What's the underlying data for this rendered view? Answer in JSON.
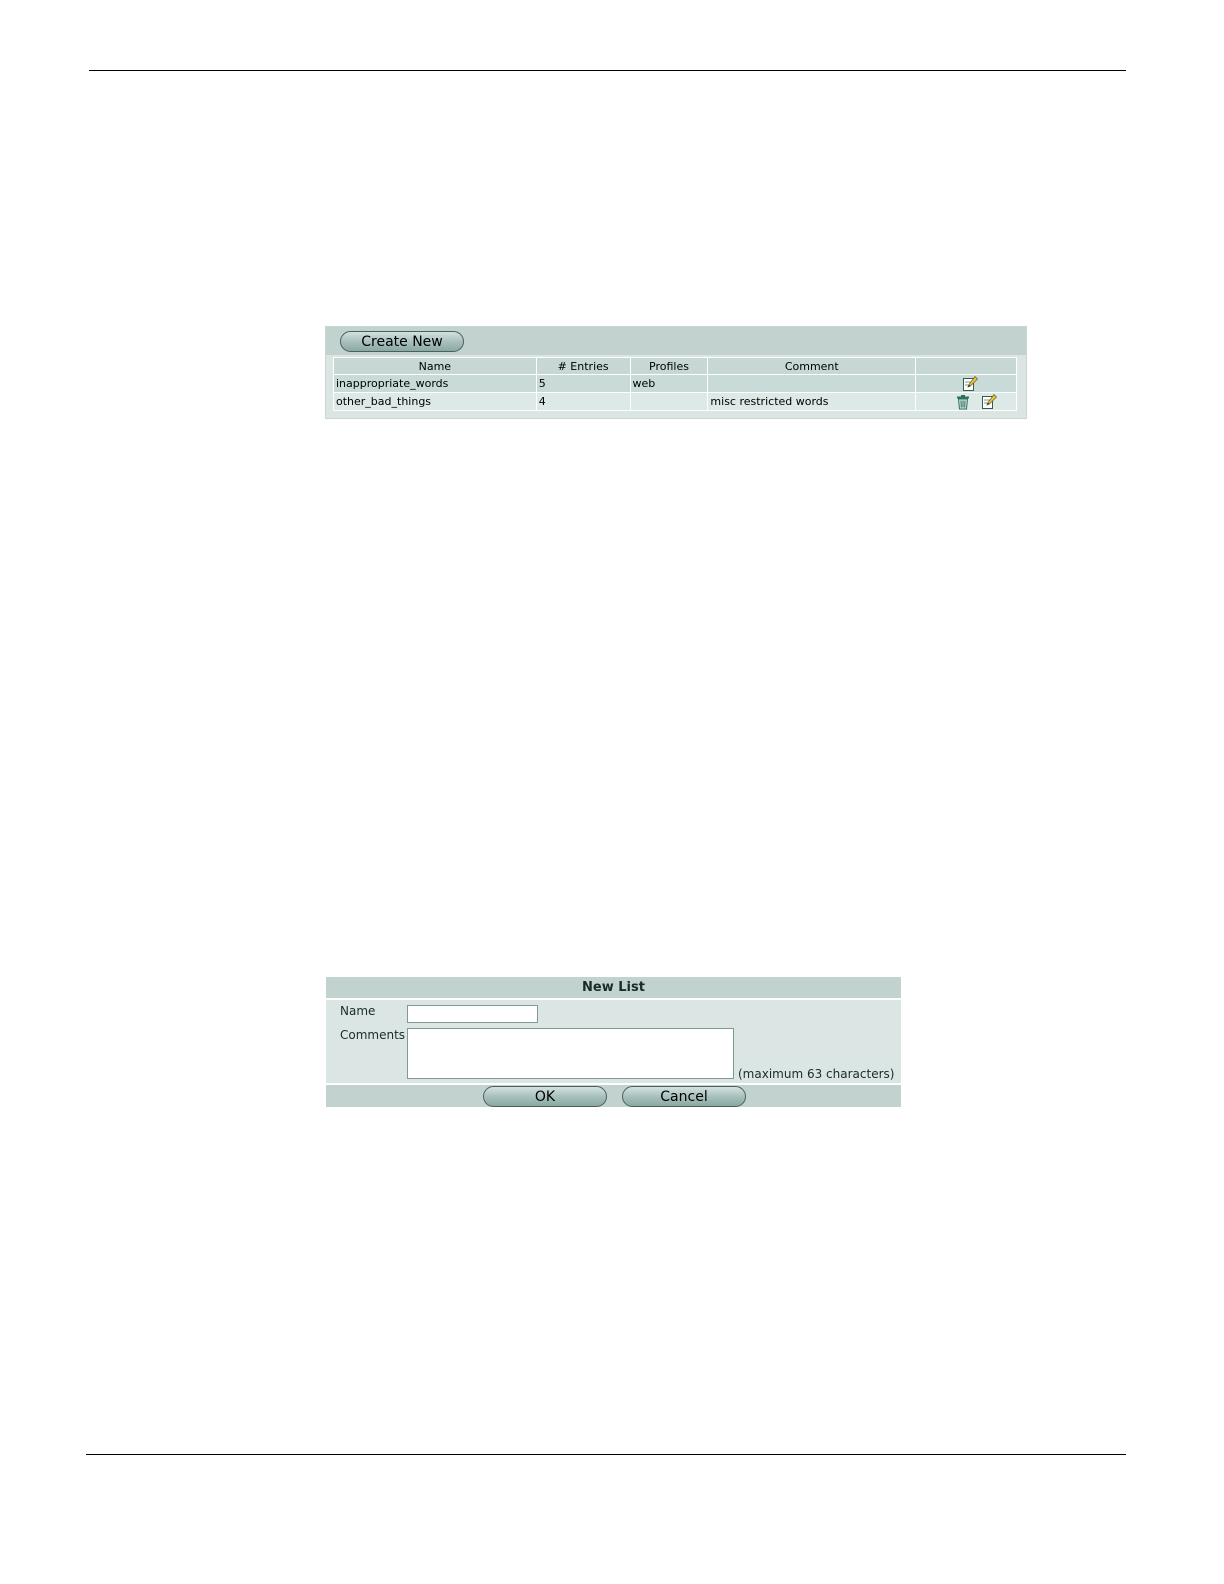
{
  "list_panel": {
    "create_new_label": "Create New",
    "columns": [
      "Name",
      "# Entries",
      "Profiles",
      "Comment",
      ""
    ],
    "rows": [
      {
        "name": "inappropriate_words",
        "entries": "5",
        "profiles": "web",
        "comment": "",
        "actions": [
          "edit"
        ]
      },
      {
        "name": "other_bad_things",
        "entries": "4",
        "profiles": "",
        "comment": "misc restricted words",
        "actions": [
          "delete",
          "edit"
        ]
      }
    ]
  },
  "new_list_form": {
    "title": "New List",
    "name_label": "Name",
    "name_value": "",
    "comments_label": "Comments",
    "comments_value": "",
    "hint": "(maximum 63 characters)",
    "ok_label": "OK",
    "cancel_label": "Cancel"
  },
  "icons": {
    "edit": "edit-icon",
    "delete": "trash-icon"
  }
}
